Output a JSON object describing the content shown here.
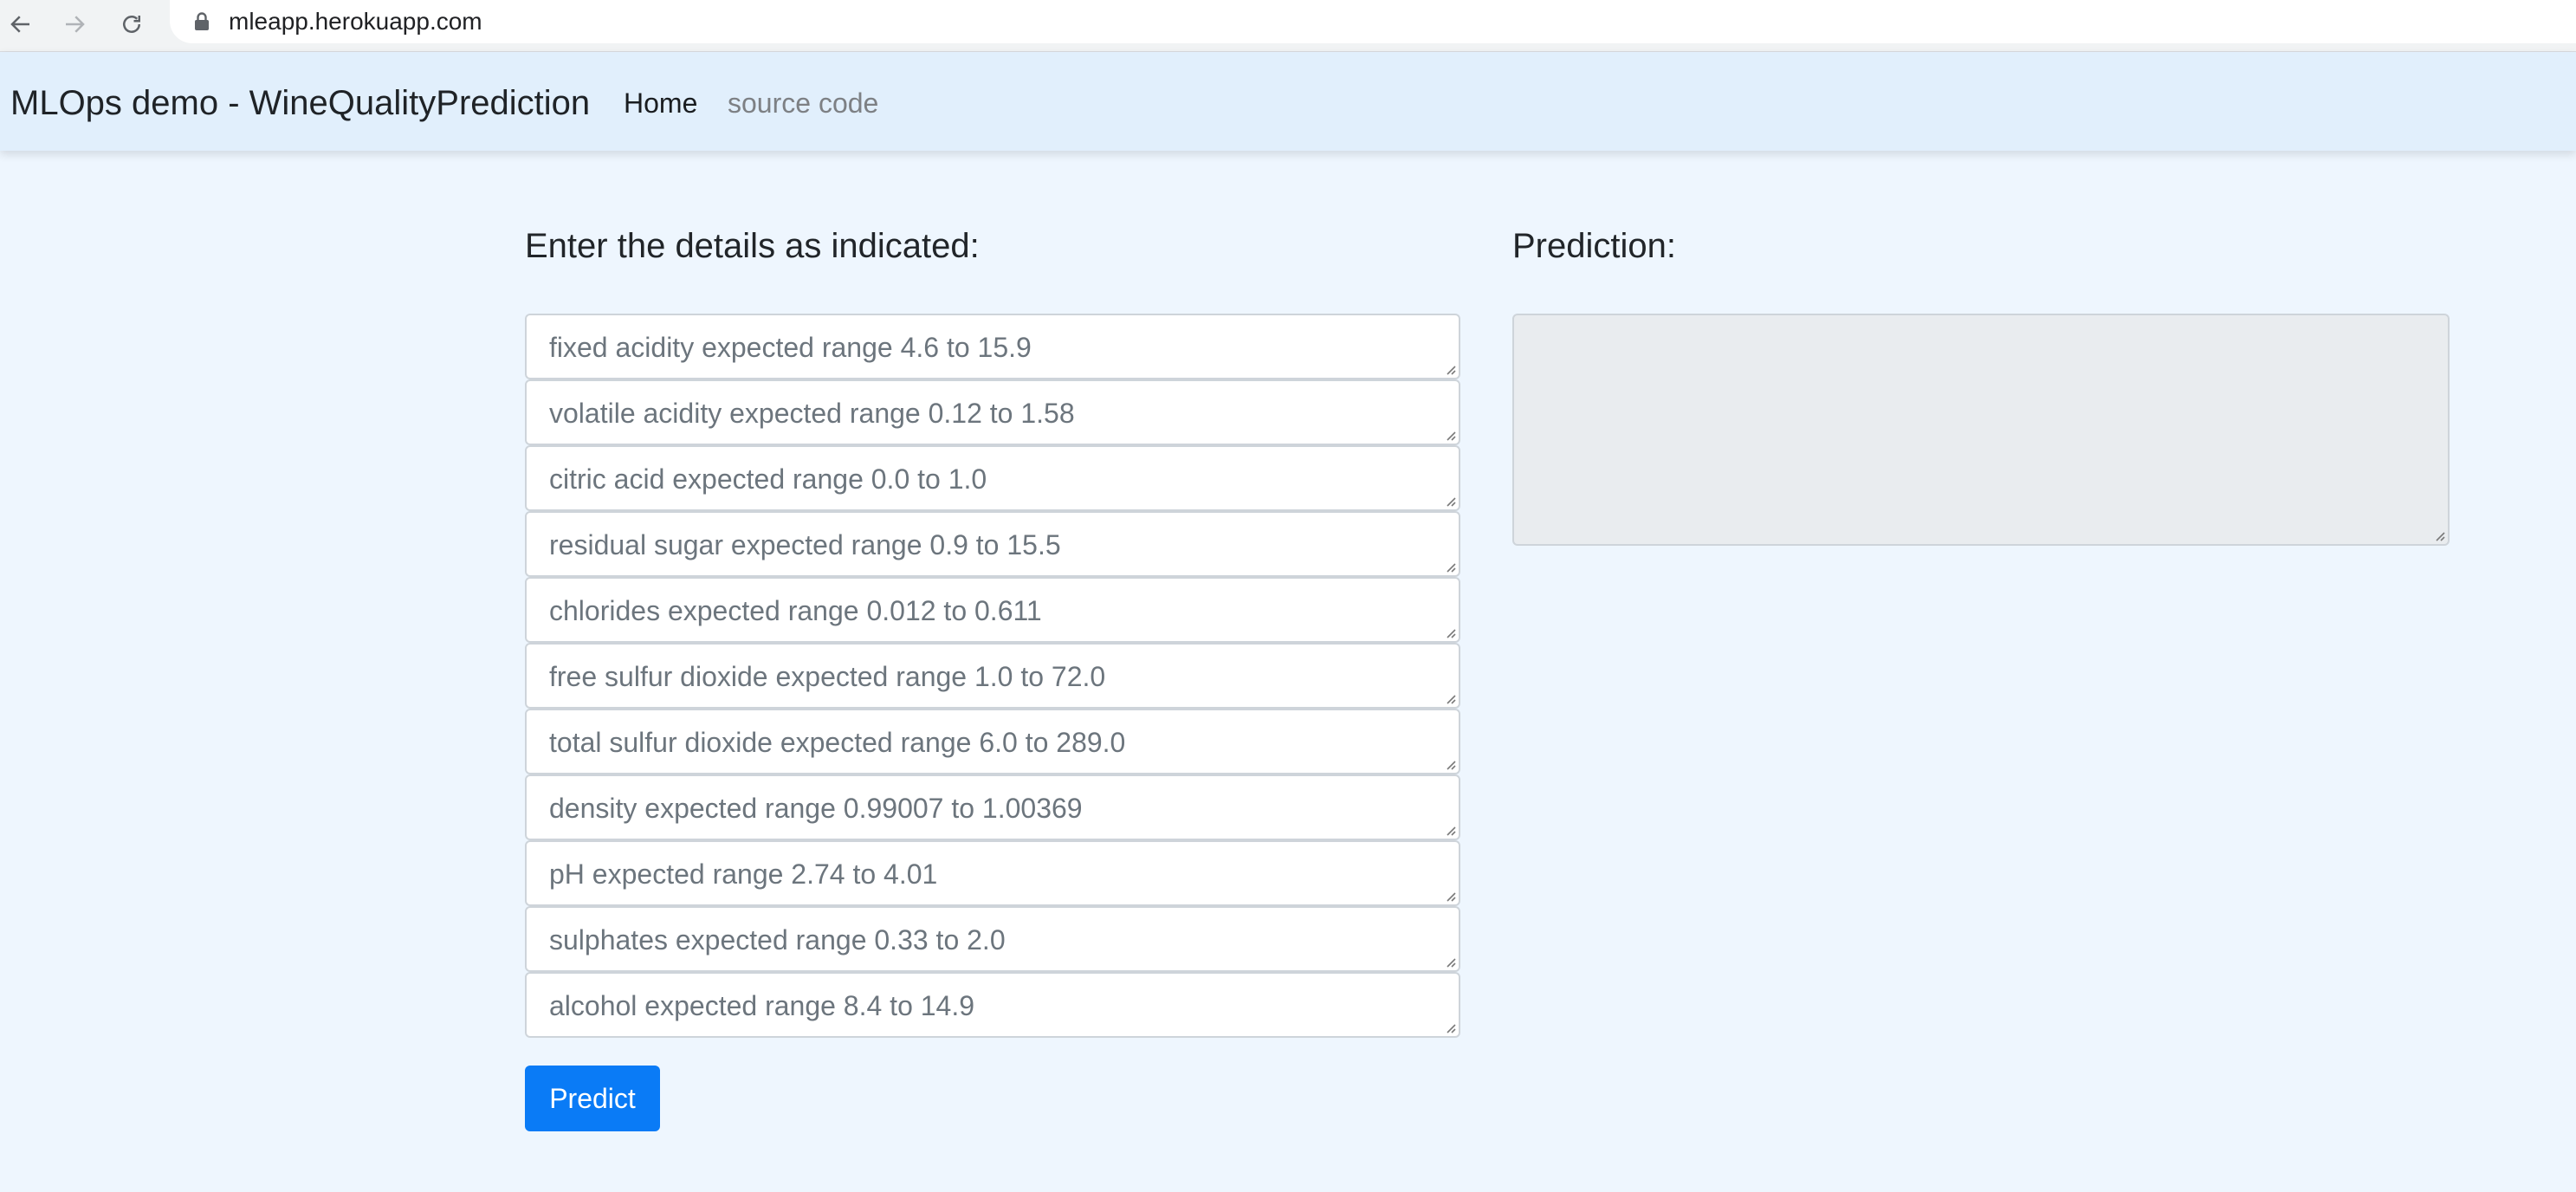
{
  "browser": {
    "url": "mleapp.herokuapp.com"
  },
  "navbar": {
    "brand": "MLOps demo - WineQualityPrediction",
    "home_label": "Home",
    "source_label": "source code"
  },
  "form": {
    "heading": "Enter the details as indicated:",
    "fields": [
      "fixed acidity expected range 4.6 to 15.9",
      "volatile acidity expected range 0.12 to 1.58",
      "citric acid expected range 0.0 to 1.0",
      "residual sugar expected range 0.9 to 15.5",
      "chlorides expected range 0.012 to 0.611",
      "free sulfur dioxide expected range 1.0 to 72.0",
      "total sulfur dioxide expected range 6.0 to 289.0",
      "density expected range 0.99007 to 1.00369",
      "pH expected range 2.74 to 4.01",
      "sulphates expected range 0.33 to 2.0",
      "alcohol expected range 8.4 to 14.9"
    ],
    "submit_label": "Predict"
  },
  "prediction": {
    "heading": "Prediction:",
    "value": ""
  },
  "colors": {
    "page_bg": "#eef6fe",
    "navbar_bg": "#e1effc",
    "primary": "#0a7bf6"
  }
}
